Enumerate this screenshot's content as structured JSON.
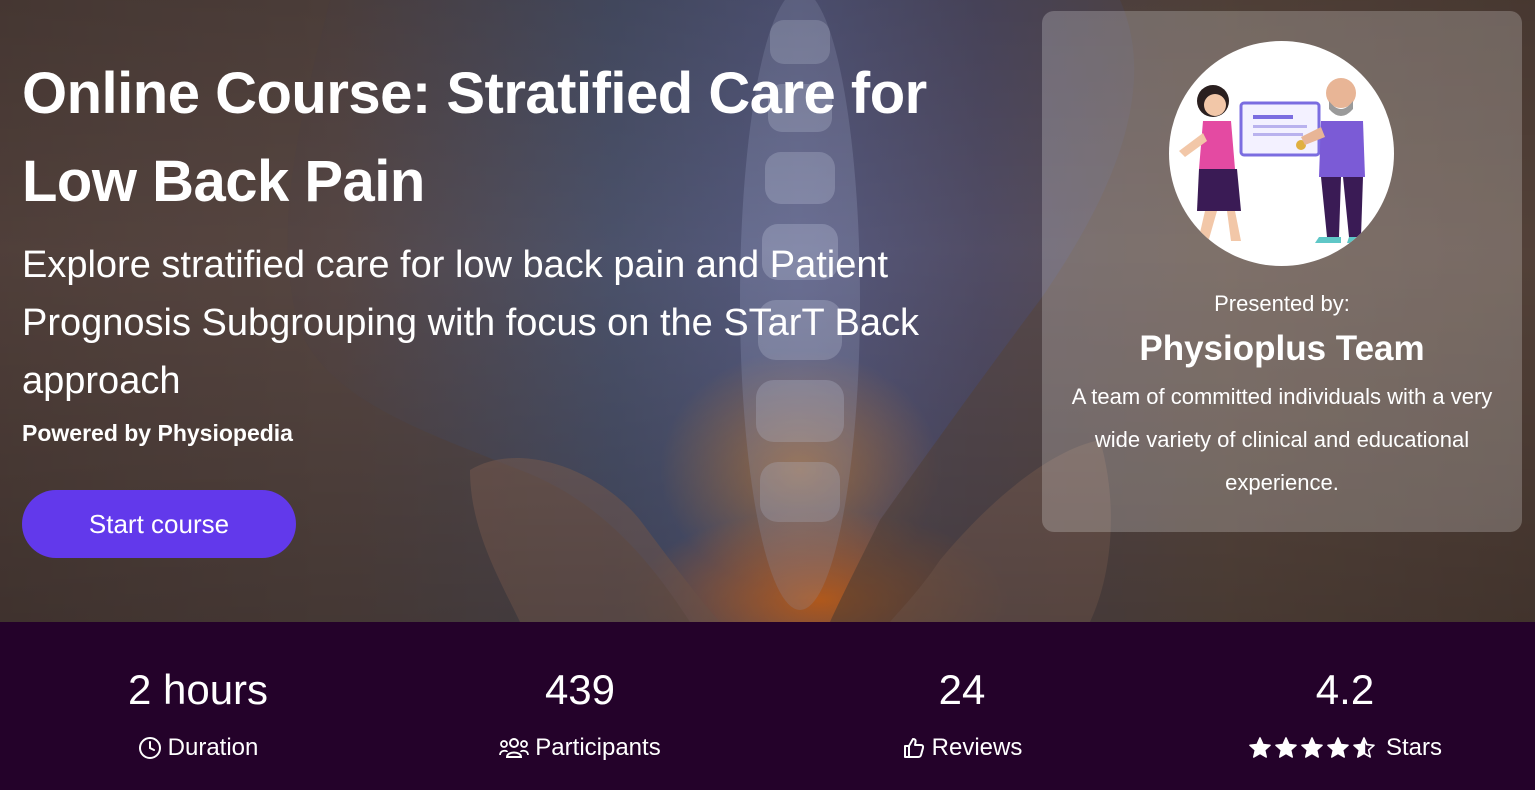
{
  "course": {
    "title": "Online Course: Stratified Care for Low Back Pain",
    "subtitle": "Explore stratified care for low back pain and Patient Prognosis Subgrouping with focus on the STarT Back approach",
    "powered_by": "Powered by Physiopedia",
    "start_label": "Start course"
  },
  "presenter": {
    "presented_by": "Presented by:",
    "name": "Physioplus Team",
    "description": "A team of committed individuals with a very wide variety of clinical and educational experience."
  },
  "stats": {
    "duration": {
      "value": "2 hours",
      "label": "Duration",
      "icon": "clock-icon"
    },
    "participants": {
      "value": "439",
      "label": "Participants",
      "icon": "users-icon"
    },
    "reviews": {
      "value": "24",
      "label": "Reviews",
      "icon": "thumbs-up-icon"
    },
    "rating": {
      "value": "4.2",
      "label": "Stars",
      "icon": "star-icon",
      "stars_filled": 4.2,
      "stars_max": 5
    }
  },
  "colors": {
    "accent": "#6239eb",
    "footer_bg": "#24022a",
    "text": "#ffffff"
  }
}
